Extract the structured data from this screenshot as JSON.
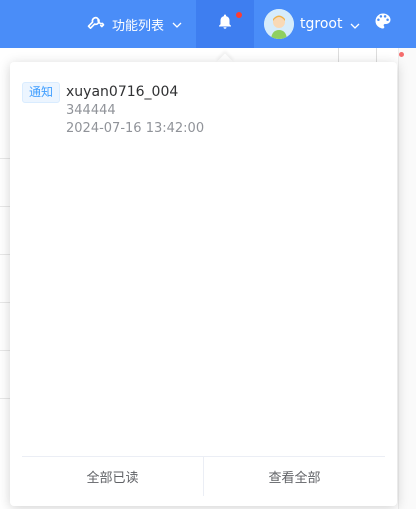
{
  "header": {
    "function_menu_label": "功能列表",
    "function_menu_icon": "wrench-icon",
    "bell_icon": "bell-icon",
    "has_unread": true,
    "user_name": "tgroot",
    "theme_icon": "palette-icon",
    "colors": {
      "bar": "#4a8df8",
      "bell_active": "#3e7ef0",
      "dot": "#ff3b30"
    }
  },
  "notifications": {
    "items": [
      {
        "tag": "通知",
        "title": "xuyan0716_004",
        "content": "344444",
        "time": "2024-07-16 13:42:00"
      }
    ],
    "mark_all_read_label": "全部已读",
    "view_all_label": "查看全部"
  }
}
